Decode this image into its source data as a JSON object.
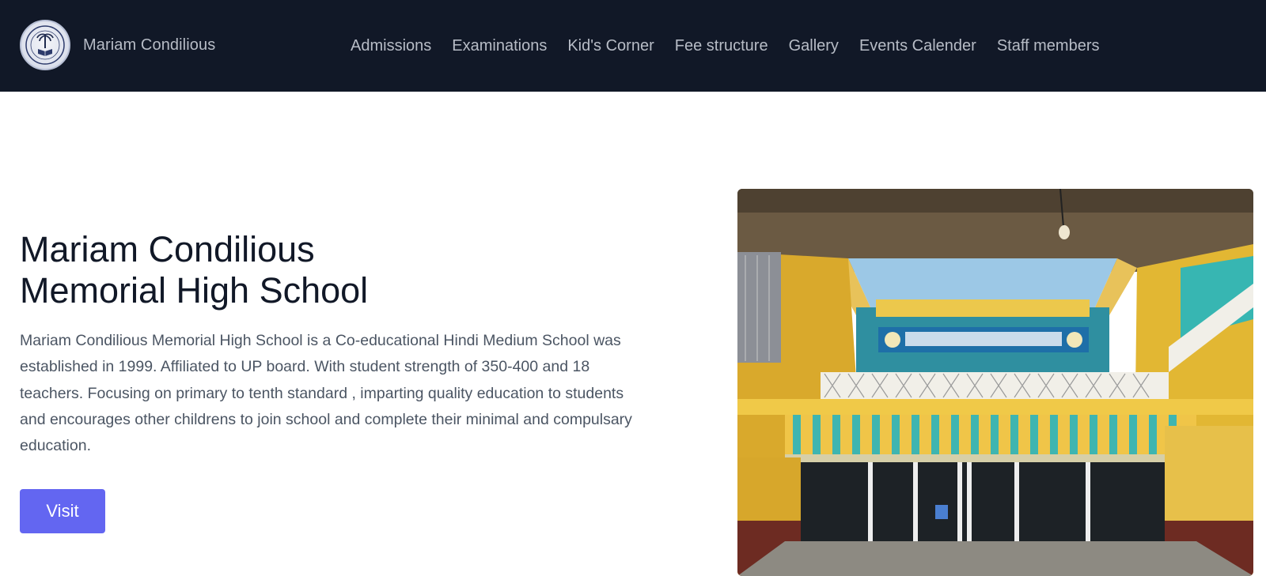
{
  "brand": {
    "name": "Mariam Condilious",
    "logo_icon": "school-emblem-icon"
  },
  "nav": {
    "items": [
      {
        "label": "Admissions"
      },
      {
        "label": "Examinations"
      },
      {
        "label": "Kid's Corner"
      },
      {
        "label": "Fee structure"
      },
      {
        "label": "Gallery"
      },
      {
        "label": "Events Calender"
      },
      {
        "label": "Staff members"
      }
    ]
  },
  "hero": {
    "title_line1": "Mariam Condilious",
    "title_line2": "Memorial High School",
    "description": "Mariam Condilious Memorial High School is a Co-educational Hindi Medium School was established in 1999. Affiliated to UP board. With student strength of 350-400 and 18 teachers. Focusing on primary to tenth standard , imparting quality education to students and encourages other childrens to join school and complete their minimal and compulsary education.",
    "button_label": "Visit",
    "image_alt": "School courtyard photo"
  },
  "colors": {
    "nav_bg": "#111827",
    "nav_text": "#b7bcc6",
    "accent": "#6366f1",
    "title": "#111827",
    "body_text": "#4b5563"
  }
}
